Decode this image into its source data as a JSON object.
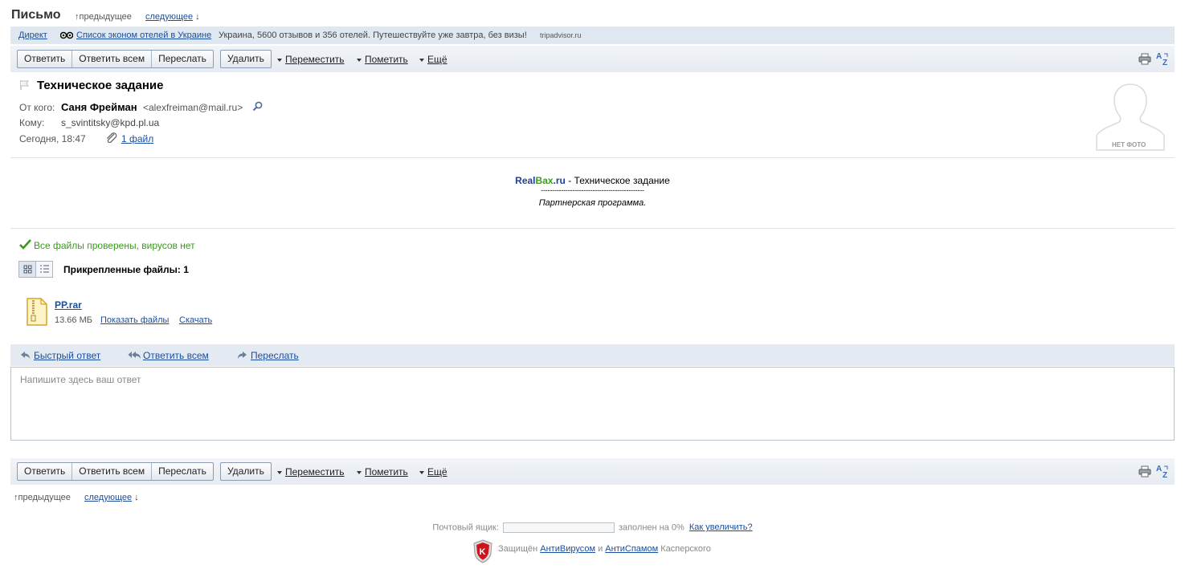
{
  "header": {
    "title": "Письмо",
    "prev": "предыдущее",
    "next": "следующее"
  },
  "ad": {
    "direct": "Директ",
    "link": "Список эконом отелей в Украине",
    "text": "Украина, 5600 отзывов и 356 отелей. Путешествуйте уже завтра, без визы!",
    "domain": "tripadvisor.ru"
  },
  "toolbar": {
    "reply": "Ответить",
    "reply_all": "Ответить всем",
    "forward": "Переслать",
    "delete": "Удалить",
    "move": "Переместить",
    "mark": "Пометить",
    "more": "Ещё"
  },
  "message": {
    "subject": "Техническое задание",
    "from_label": "От кого:",
    "from_name": "Саня Фрейман",
    "from_email": "<alexfreiman@mail.ru>",
    "to_label": "Кому:",
    "to": "s_svintitsky@kpd.pl.ua",
    "date": "Сегодня, 18:47",
    "attachments_link": "1 файл",
    "no_photo": "НЕТ ФОТО"
  },
  "body": {
    "brand_real": "Real",
    "brand_bax": "Bax",
    "brand_ru": ".ru",
    "title_rest": " - Техническое задание",
    "divider": "----------------------------------------------",
    "subtitle": "Партнерская программа."
  },
  "attachments": {
    "scan_status": "Все файлы проверены, вирусов нет",
    "heading": "Прикрепленные файлы: 1",
    "files": [
      {
        "name": "PP.rar",
        "size": "13.66 МБ",
        "show": "Показать файлы",
        "download": "Скачать"
      }
    ]
  },
  "reply": {
    "quick": "Быстрый ответ",
    "reply_all": "Ответить всем",
    "forward": "Переслать",
    "placeholder": "Напишите здесь ваш ответ"
  },
  "footer": {
    "prev": "предыдущее",
    "next": "следующее",
    "mailbox_label": "Почтовый ящик:",
    "filled": "заполнен на 0%",
    "increase": "Как увеличить?",
    "filled_fraction": 0,
    "protected": "Защищён",
    "antivirus": "АнтиВирусом",
    "and": "и",
    "antispam": "АнтиСпамом",
    "kaspersky": "Касперского"
  },
  "colors": {
    "link": "#1a4e9c",
    "ok_green": "#3a9a1b",
    "brand_blue": "#1f3f9f",
    "brand_green": "#3d9a1d",
    "toolbar_bg": "#e6ebf1"
  }
}
